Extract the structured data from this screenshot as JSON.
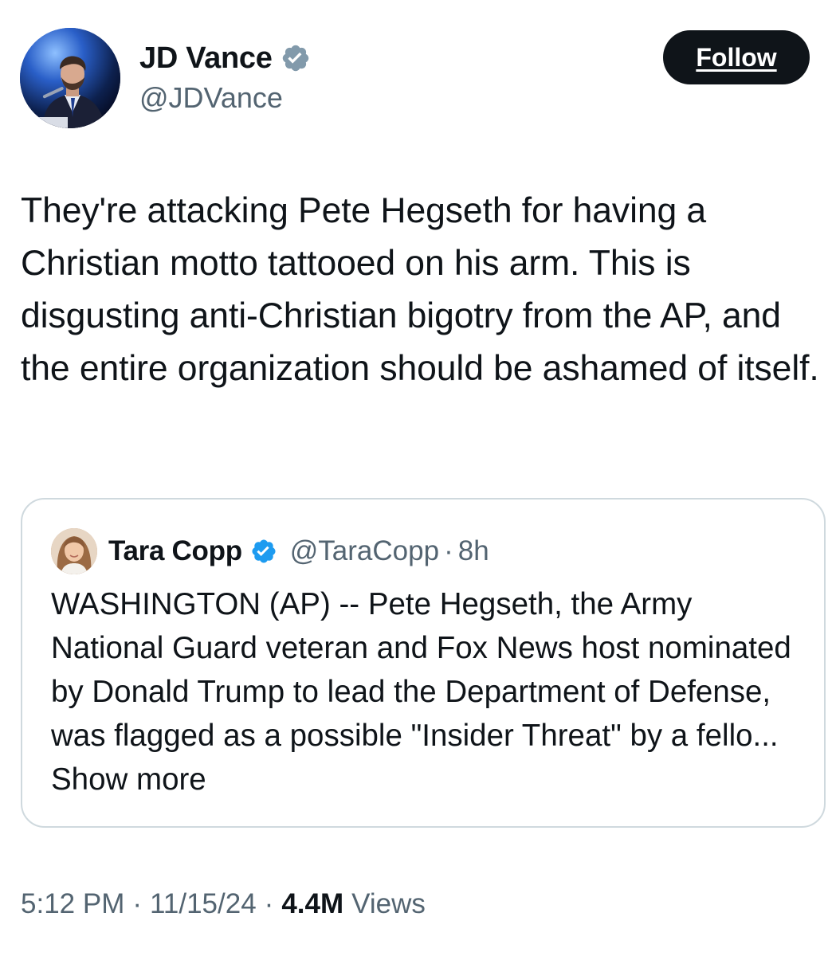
{
  "author": {
    "name": "JD Vance",
    "handle": "@JDVance",
    "verified_icon": "verified-badge-icon",
    "verified_color": "#1d9bf0"
  },
  "follow_button": {
    "label": "Follow"
  },
  "tweet": {
    "text": "They're attacking Pete Hegseth for having a Christian motto tattooed on his arm. This is disgusting anti-Christian bigotry from the AP, and the entire organization should be ashamed of itself."
  },
  "quoted_tweet": {
    "name": "Tara Copp",
    "handle": "@TaraCopp",
    "separator": "·",
    "time": "8h",
    "text": "WASHINGTON (AP) -- Pete Hegseth, the Army National Guard veteran and Fox News host nominated by Donald Trump to lead the Department of Defense, was flagged as a possible \"Insider Threat\" by a fello...",
    "show_more": "Show more"
  },
  "meta": {
    "time": "5:12 PM",
    "date": "11/15/24",
    "separator": "·",
    "views_count": "4.4M",
    "views_label": "Views"
  },
  "colors": {
    "text": "#0f1419",
    "secondary": "#536471",
    "border": "#cfd9de",
    "button_bg": "#0f1419",
    "button_text": "#ffffff"
  }
}
